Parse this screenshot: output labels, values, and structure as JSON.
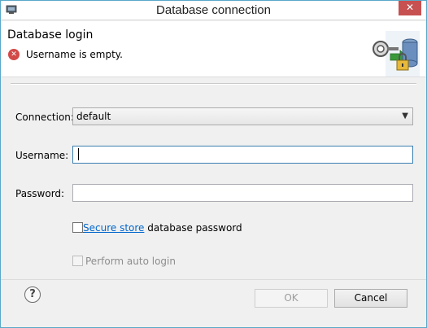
{
  "window": {
    "title": "Database connection",
    "close_glyph": "✕"
  },
  "header": {
    "title": "Database login",
    "error_message": "Username is empty.",
    "error_glyph": "✕",
    "icon": "database-key-icon"
  },
  "form": {
    "connection_label": "Connection:",
    "connection_value": "default",
    "username_label": "Username:",
    "username_value": "",
    "password_label": "Password:",
    "password_value": "",
    "secure_store_link": "Secure store",
    "secure_store_suffix": " database password",
    "auto_login_label": "Perform auto login"
  },
  "footer": {
    "help_glyph": "?",
    "ok_label": "OK",
    "cancel_label": "Cancel"
  },
  "colors": {
    "accent": "#3c7fb1",
    "error": "#d24a48",
    "link": "#0066cc"
  }
}
